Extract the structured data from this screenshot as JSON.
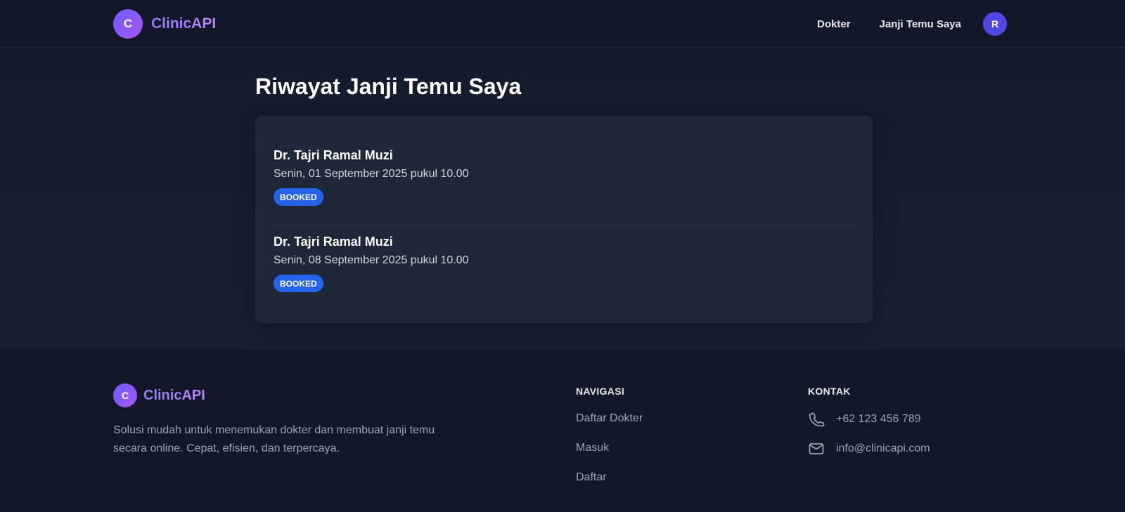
{
  "header": {
    "logo_letter": "C",
    "brand": "ClinicAPI",
    "nav": [
      "Dokter",
      "Janji Temu Saya"
    ],
    "avatar_letter": "R"
  },
  "main": {
    "title": "Riwayat Janji Temu Saya",
    "appointments": [
      {
        "doctor": "Dr. Tajri Ramal Muzi",
        "schedule": "Senin, 01 September 2025 pukul 10.00",
        "status": "BOOKED"
      },
      {
        "doctor": "Dr. Tajri Ramal Muzi",
        "schedule": "Senin, 08 September 2025 pukul 10.00",
        "status": "BOOKED"
      }
    ]
  },
  "footer": {
    "logo_letter": "C",
    "brand": "ClinicAPI",
    "description": "Solusi mudah untuk menemukan dokter dan membuat janji temu secara online. Cepat, efisien, dan terpercaya.",
    "nav_title": "NAVIGASI",
    "nav_links": [
      "Daftar Dokter",
      "Masuk",
      "Daftar"
    ],
    "contact_title": "KONTAK",
    "phone": "+62 123 456 789",
    "email": "info@clinicapi.com",
    "phone_icon": "phone-icon",
    "email_icon": "mail-icon"
  },
  "colors": {
    "background": "#141a2b",
    "header_bg": "#121828",
    "card_bg": "#1f2838",
    "accent_purple": "#a78bfa",
    "badge_blue": "#2563eb",
    "avatar_indigo": "#5046e5"
  }
}
